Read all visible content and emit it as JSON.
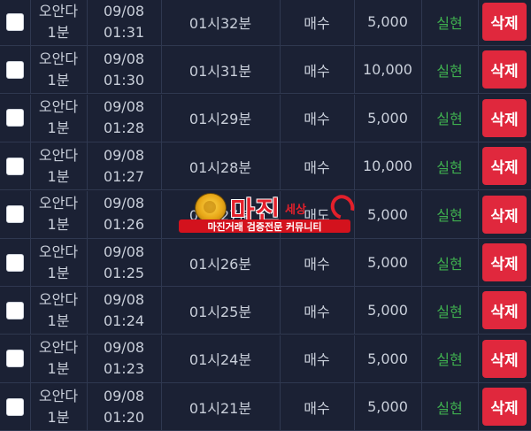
{
  "rows": [
    {
      "game_line1": "오안다",
      "game_line2": "1분",
      "date": "09/08",
      "time": "01:31",
      "round": "01시32분",
      "pick": "매수",
      "amount": "5,000",
      "status": "실현",
      "delete_label": "삭제"
    },
    {
      "game_line1": "오안다",
      "game_line2": "1분",
      "date": "09/08",
      "time": "01:30",
      "round": "01시31분",
      "pick": "매수",
      "amount": "10,000",
      "status": "실현",
      "delete_label": "삭제"
    },
    {
      "game_line1": "오안다",
      "game_line2": "1분",
      "date": "09/08",
      "time": "01:28",
      "round": "01시29분",
      "pick": "매수",
      "amount": "5,000",
      "status": "실현",
      "delete_label": "삭제"
    },
    {
      "game_line1": "오안다",
      "game_line2": "1분",
      "date": "09/08",
      "time": "01:27",
      "round": "01시28분",
      "pick": "매수",
      "amount": "10,000",
      "status": "실현",
      "delete_label": "삭제"
    },
    {
      "game_line1": "오안다",
      "game_line2": "1분",
      "date": "09/08",
      "time": "01:26",
      "round": "01시27분",
      "pick": "매도",
      "amount": "5,000",
      "status": "실현",
      "delete_label": "삭제"
    },
    {
      "game_line1": "오안다",
      "game_line2": "1분",
      "date": "09/08",
      "time": "01:25",
      "round": "01시26분",
      "pick": "매수",
      "amount": "5,000",
      "status": "실현",
      "delete_label": "삭제"
    },
    {
      "game_line1": "오안다",
      "game_line2": "1분",
      "date": "09/08",
      "time": "01:24",
      "round": "01시25분",
      "pick": "매수",
      "amount": "5,000",
      "status": "실현",
      "delete_label": "삭제"
    },
    {
      "game_line1": "오안다",
      "game_line2": "1분",
      "date": "09/08",
      "time": "01:23",
      "round": "01시24분",
      "pick": "매수",
      "amount": "5,000",
      "status": "실현",
      "delete_label": "삭제"
    },
    {
      "game_line1": "오안다",
      "game_line2": "1분",
      "date": "09/08",
      "time": "01:20",
      "round": "01시21분",
      "pick": "매수",
      "amount": "5,000",
      "status": "실현",
      "delete_label": "삭제"
    }
  ],
  "watermark": {
    "title": "마진",
    "suffix": "세상",
    "banner": "마진거래 검증전문 커뮤니티"
  },
  "colors": {
    "background": "#1a2032",
    "status_green": "#3faf4f",
    "delete_red": "#e0283d"
  }
}
